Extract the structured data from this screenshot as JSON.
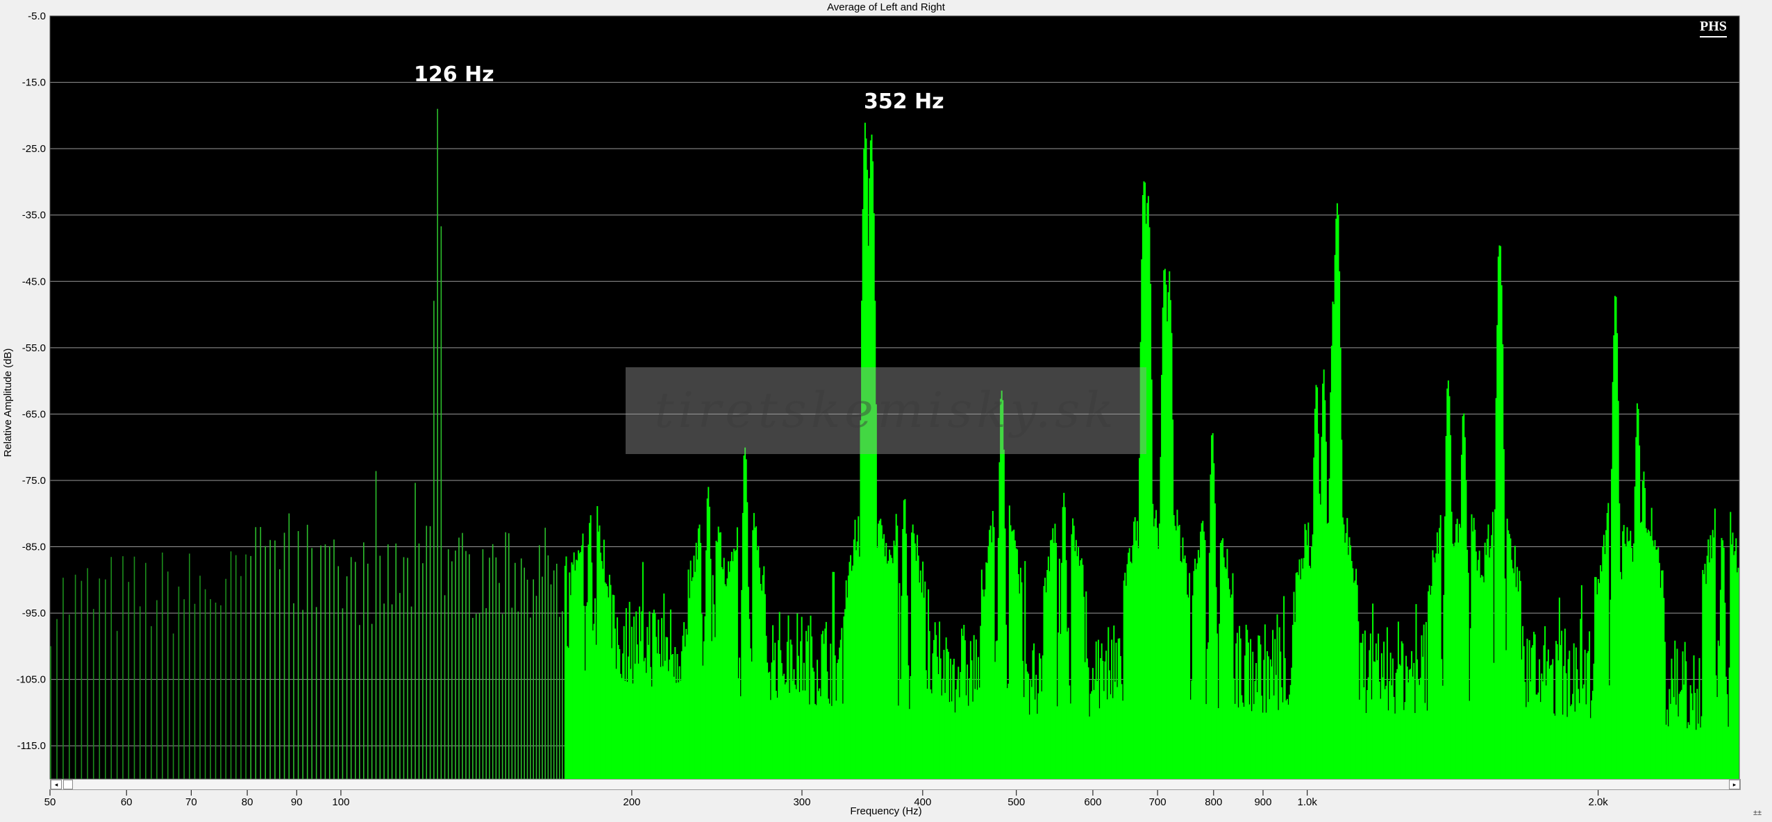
{
  "chart_data": {
    "type": "area",
    "title": "Average of Left and Right",
    "xlabel": "Frequency (Hz)",
    "ylabel": "Relative Amplitude (dB)",
    "x_scale": "log",
    "xlim": [
      50,
      2800
    ],
    "ylim": [
      -120,
      -5
    ],
    "y_ticks": [
      -5,
      -15,
      -25,
      -35,
      -45,
      -55,
      -65,
      -75,
      -85,
      -95,
      -105,
      -115
    ],
    "y_tick_labels": [
      "-5.0",
      "-15.0",
      "-25.0",
      "-35.0",
      "-45.0",
      "-55.0",
      "-65.0",
      "-75.0",
      "-85.0",
      "-95.0",
      "-105.0",
      "-115.0"
    ],
    "x_ticks": [
      50,
      60,
      70,
      80,
      90,
      100,
      200,
      300,
      400,
      500,
      600,
      700,
      800,
      900,
      1000,
      2000
    ],
    "x_tick_labels": [
      "50",
      "60",
      "70",
      "80",
      "90",
      "100",
      "200",
      "300",
      "400",
      "500",
      "600",
      "700",
      "800",
      "900",
      "1.0k",
      "2.0k"
    ],
    "grid": true,
    "background": "#000000",
    "series_color": "#00ff00",
    "peaks": [
      {
        "x": 83,
        "y": -71
      },
      {
        "x": 90,
        "y": -76
      },
      {
        "x": 126,
        "y": -16.5
      },
      {
        "x": 181,
        "y": -79
      },
      {
        "x": 240,
        "y": -75
      },
      {
        "x": 262,
        "y": -68.5
      },
      {
        "x": 349,
        "y": -20.5
      },
      {
        "x": 354,
        "y": -20.5
      },
      {
        "x": 383,
        "y": -76
      },
      {
        "x": 483,
        "y": -60
      },
      {
        "x": 560,
        "y": -76
      },
      {
        "x": 678,
        "y": -28.5
      },
      {
        "x": 684,
        "y": -30
      },
      {
        "x": 712,
        "y": -40
      },
      {
        "x": 720,
        "y": -42.5
      },
      {
        "x": 798,
        "y": -66
      },
      {
        "x": 1022,
        "y": -59
      },
      {
        "x": 1040,
        "y": -58
      },
      {
        "x": 1064,
        "y": -47
      },
      {
        "x": 1074,
        "y": -31
      },
      {
        "x": 1400,
        "y": -58
      },
      {
        "x": 1452,
        "y": -63
      },
      {
        "x": 1582,
        "y": -37
      },
      {
        "x": 2084,
        "y": -46
      },
      {
        "x": 2197,
        "y": -63
      },
      {
        "x": 2230,
        "y": -71
      },
      {
        "x": 2690,
        "y": -81
      }
    ],
    "annotations": [
      {
        "text": "126 Hz",
        "x": 126
      },
      {
        "text": "352 Hz",
        "x": 352
      }
    ],
    "watermark": "tiretskemisky.sk",
    "logo": "PHS"
  },
  "controls": {
    "scroll_left_icon": "◂",
    "scroll_right_icon": "▸",
    "corner_icon": "±±"
  }
}
